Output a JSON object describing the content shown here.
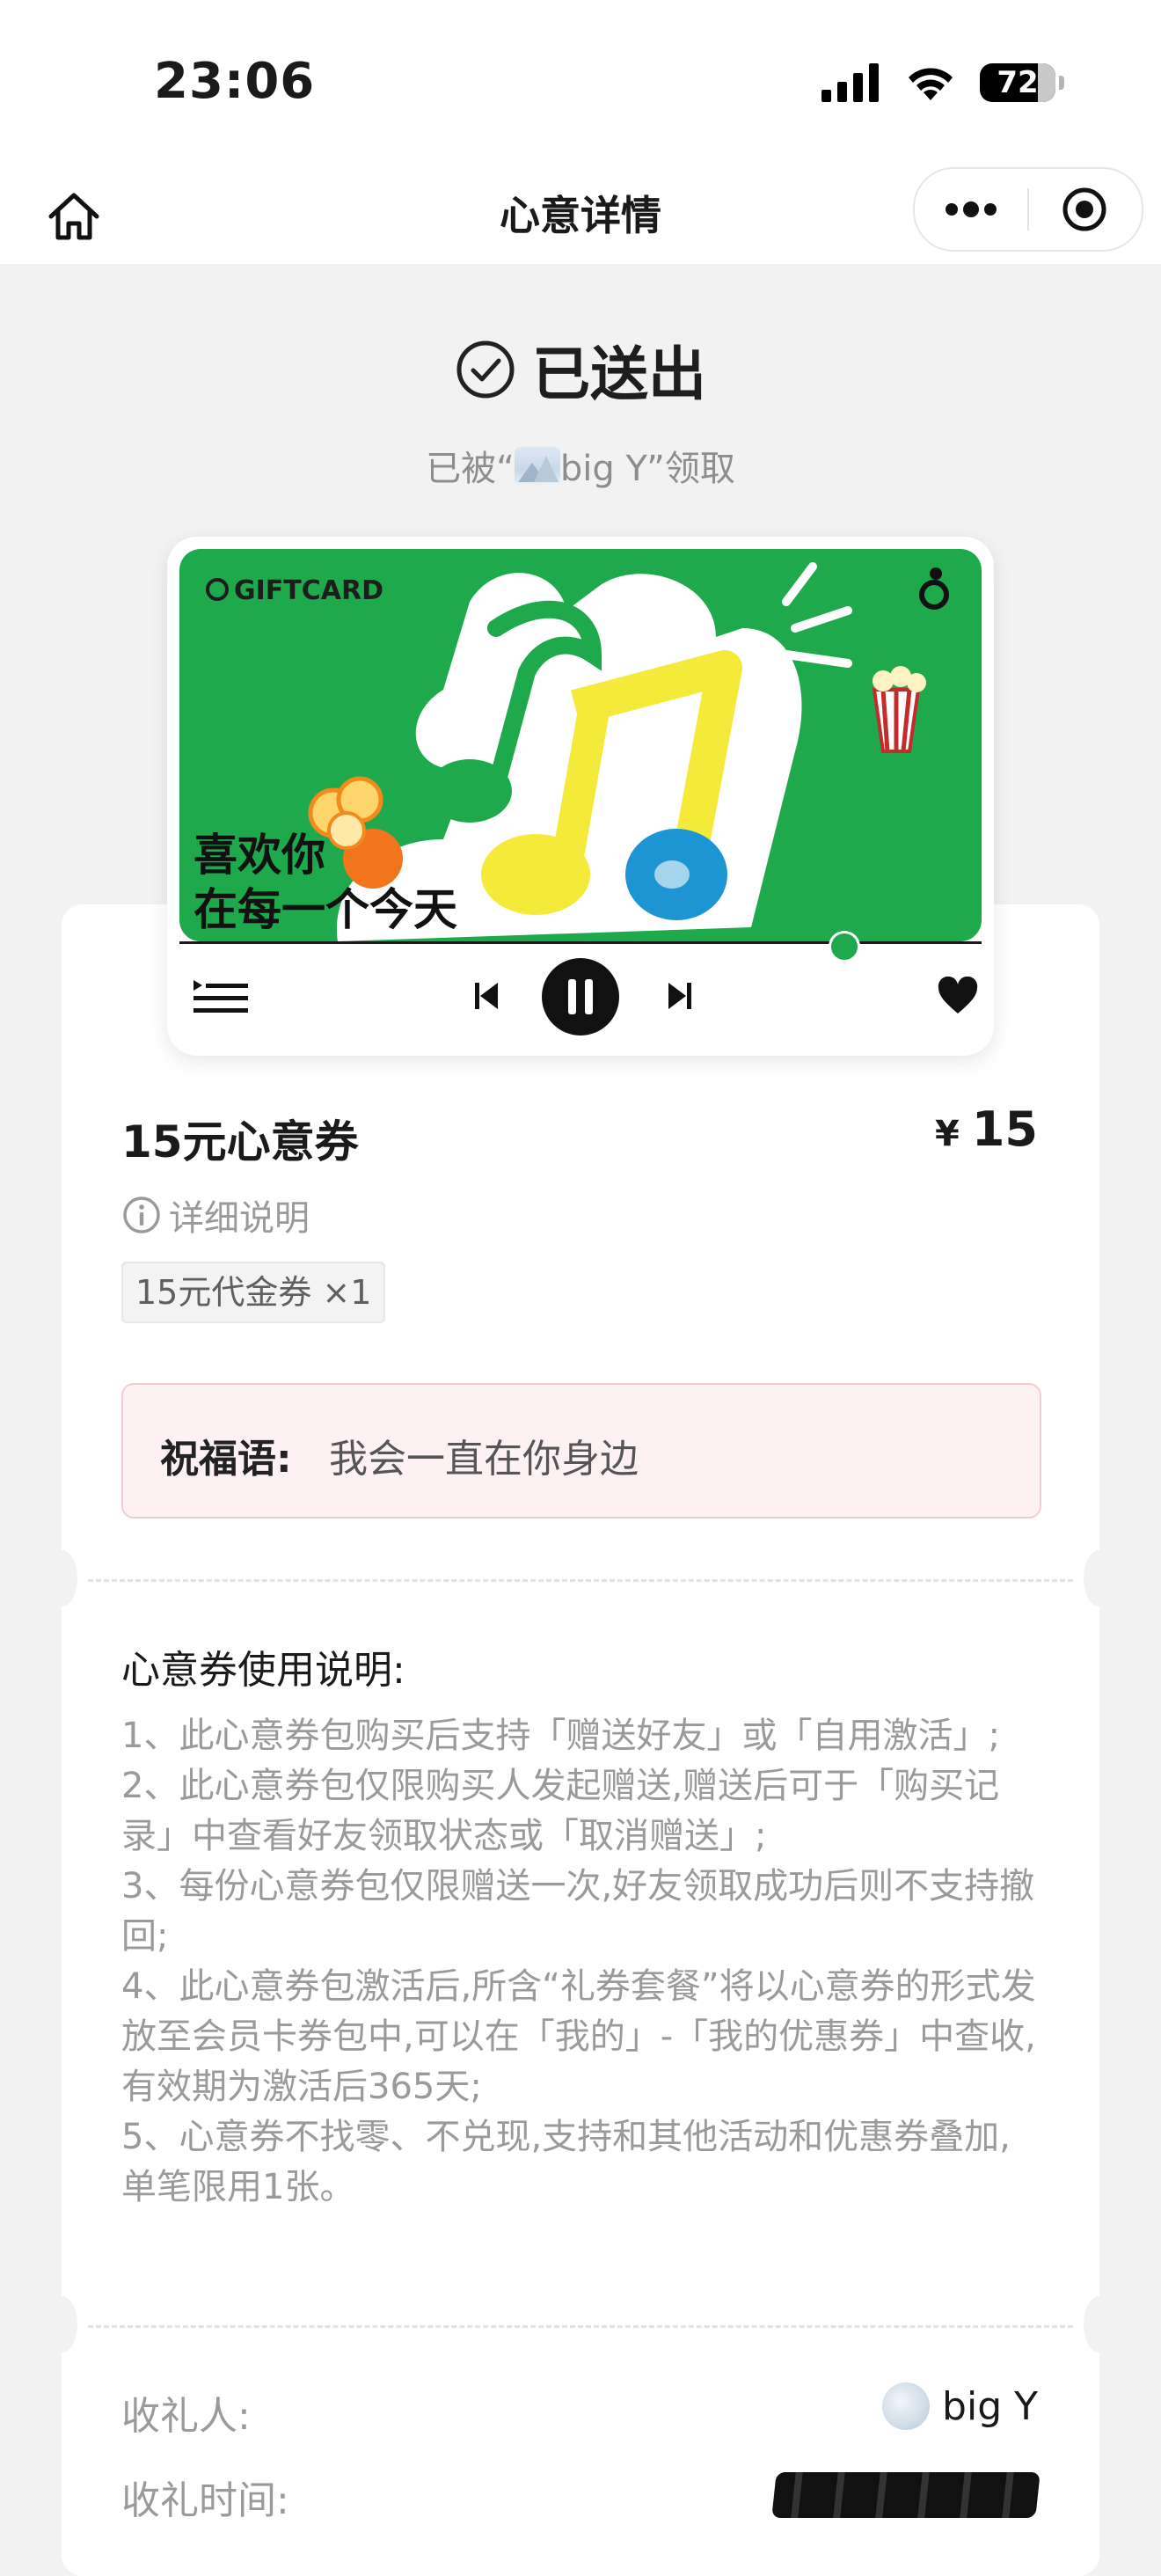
{
  "status_bar": {
    "time": "23:06",
    "battery": "72"
  },
  "nav": {
    "title": "心意详情"
  },
  "state": {
    "title": "已送出",
    "receiver_prefix": "已被“",
    "receiver_name": "big Y",
    "receiver_suffix": "”领取"
  },
  "gift_card": {
    "logo": "GIFTCARD",
    "line1": "喜欢你",
    "line2": "在每一个今天",
    "colors": {
      "background": "#1ea94c",
      "note_yellow": "#f3ea3a",
      "dot_orange": "#f2741d",
      "dot_blue": "#1e95d3"
    }
  },
  "coupon": {
    "title": "15元心意券",
    "currency": "¥",
    "price": "15",
    "detail_link": "详细说明",
    "tag": "15元代金券 ×1"
  },
  "blessing": {
    "label": "祝福语:",
    "text": "我会一直在你身边"
  },
  "instructions": {
    "title": "心意券使用说明:",
    "items": [
      "1、此心意券包购买后支持「赠送好友」或「自用激活」;",
      "2、此心意券包仅限购买人发起赠送,赠送后可于「购买记录」中查看好友领取状态或「取消赠送」;",
      "3、每份心意券包仅限赠送一次,好友领取成功后则不支持撤回;",
      "4、此心意券包激活后,所含“礼券套餐”将以心意券的形式发放至会员卡券包中,可以在「我的」-「我的优惠券」中查收,有效期为激活后365天;",
      "5、心意券不找零、不兑现,支持和其他活动和优惠券叠加,单笔限用1张。"
    ]
  },
  "receiver": {
    "label": "收礼人:",
    "name": "big Y",
    "time_label": "收礼时间:"
  }
}
